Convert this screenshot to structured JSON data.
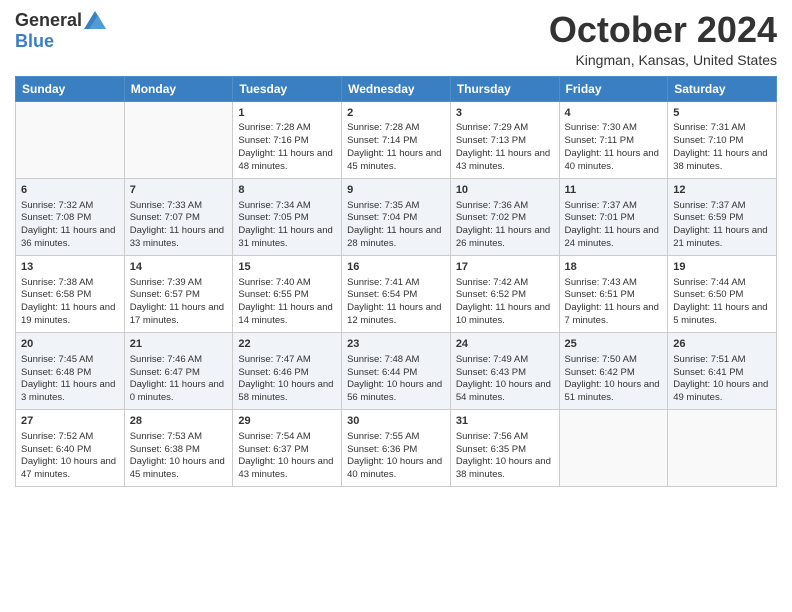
{
  "header": {
    "logo_general": "General",
    "logo_blue": "Blue",
    "month_title": "October 2024",
    "location": "Kingman, Kansas, United States"
  },
  "days_of_week": [
    "Sunday",
    "Monday",
    "Tuesday",
    "Wednesday",
    "Thursday",
    "Friday",
    "Saturday"
  ],
  "weeks": [
    [
      {
        "day": "",
        "content": ""
      },
      {
        "day": "",
        "content": ""
      },
      {
        "day": "1",
        "content": "Sunrise: 7:28 AM\nSunset: 7:16 PM\nDaylight: 11 hours and 48 minutes."
      },
      {
        "day": "2",
        "content": "Sunrise: 7:28 AM\nSunset: 7:14 PM\nDaylight: 11 hours and 45 minutes."
      },
      {
        "day": "3",
        "content": "Sunrise: 7:29 AM\nSunset: 7:13 PM\nDaylight: 11 hours and 43 minutes."
      },
      {
        "day": "4",
        "content": "Sunrise: 7:30 AM\nSunset: 7:11 PM\nDaylight: 11 hours and 40 minutes."
      },
      {
        "day": "5",
        "content": "Sunrise: 7:31 AM\nSunset: 7:10 PM\nDaylight: 11 hours and 38 minutes."
      }
    ],
    [
      {
        "day": "6",
        "content": "Sunrise: 7:32 AM\nSunset: 7:08 PM\nDaylight: 11 hours and 36 minutes."
      },
      {
        "day": "7",
        "content": "Sunrise: 7:33 AM\nSunset: 7:07 PM\nDaylight: 11 hours and 33 minutes."
      },
      {
        "day": "8",
        "content": "Sunrise: 7:34 AM\nSunset: 7:05 PM\nDaylight: 11 hours and 31 minutes."
      },
      {
        "day": "9",
        "content": "Sunrise: 7:35 AM\nSunset: 7:04 PM\nDaylight: 11 hours and 28 minutes."
      },
      {
        "day": "10",
        "content": "Sunrise: 7:36 AM\nSunset: 7:02 PM\nDaylight: 11 hours and 26 minutes."
      },
      {
        "day": "11",
        "content": "Sunrise: 7:37 AM\nSunset: 7:01 PM\nDaylight: 11 hours and 24 minutes."
      },
      {
        "day": "12",
        "content": "Sunrise: 7:37 AM\nSunset: 6:59 PM\nDaylight: 11 hours and 21 minutes."
      }
    ],
    [
      {
        "day": "13",
        "content": "Sunrise: 7:38 AM\nSunset: 6:58 PM\nDaylight: 11 hours and 19 minutes."
      },
      {
        "day": "14",
        "content": "Sunrise: 7:39 AM\nSunset: 6:57 PM\nDaylight: 11 hours and 17 minutes."
      },
      {
        "day": "15",
        "content": "Sunrise: 7:40 AM\nSunset: 6:55 PM\nDaylight: 11 hours and 14 minutes."
      },
      {
        "day": "16",
        "content": "Sunrise: 7:41 AM\nSunset: 6:54 PM\nDaylight: 11 hours and 12 minutes."
      },
      {
        "day": "17",
        "content": "Sunrise: 7:42 AM\nSunset: 6:52 PM\nDaylight: 11 hours and 10 minutes."
      },
      {
        "day": "18",
        "content": "Sunrise: 7:43 AM\nSunset: 6:51 PM\nDaylight: 11 hours and 7 minutes."
      },
      {
        "day": "19",
        "content": "Sunrise: 7:44 AM\nSunset: 6:50 PM\nDaylight: 11 hours and 5 minutes."
      }
    ],
    [
      {
        "day": "20",
        "content": "Sunrise: 7:45 AM\nSunset: 6:48 PM\nDaylight: 11 hours and 3 minutes."
      },
      {
        "day": "21",
        "content": "Sunrise: 7:46 AM\nSunset: 6:47 PM\nDaylight: 11 hours and 0 minutes."
      },
      {
        "day": "22",
        "content": "Sunrise: 7:47 AM\nSunset: 6:46 PM\nDaylight: 10 hours and 58 minutes."
      },
      {
        "day": "23",
        "content": "Sunrise: 7:48 AM\nSunset: 6:44 PM\nDaylight: 10 hours and 56 minutes."
      },
      {
        "day": "24",
        "content": "Sunrise: 7:49 AM\nSunset: 6:43 PM\nDaylight: 10 hours and 54 minutes."
      },
      {
        "day": "25",
        "content": "Sunrise: 7:50 AM\nSunset: 6:42 PM\nDaylight: 10 hours and 51 minutes."
      },
      {
        "day": "26",
        "content": "Sunrise: 7:51 AM\nSunset: 6:41 PM\nDaylight: 10 hours and 49 minutes."
      }
    ],
    [
      {
        "day": "27",
        "content": "Sunrise: 7:52 AM\nSunset: 6:40 PM\nDaylight: 10 hours and 47 minutes."
      },
      {
        "day": "28",
        "content": "Sunrise: 7:53 AM\nSunset: 6:38 PM\nDaylight: 10 hours and 45 minutes."
      },
      {
        "day": "29",
        "content": "Sunrise: 7:54 AM\nSunset: 6:37 PM\nDaylight: 10 hours and 43 minutes."
      },
      {
        "day": "30",
        "content": "Sunrise: 7:55 AM\nSunset: 6:36 PM\nDaylight: 10 hours and 40 minutes."
      },
      {
        "day": "31",
        "content": "Sunrise: 7:56 AM\nSunset: 6:35 PM\nDaylight: 10 hours and 38 minutes."
      },
      {
        "day": "",
        "content": ""
      },
      {
        "day": "",
        "content": ""
      }
    ]
  ]
}
